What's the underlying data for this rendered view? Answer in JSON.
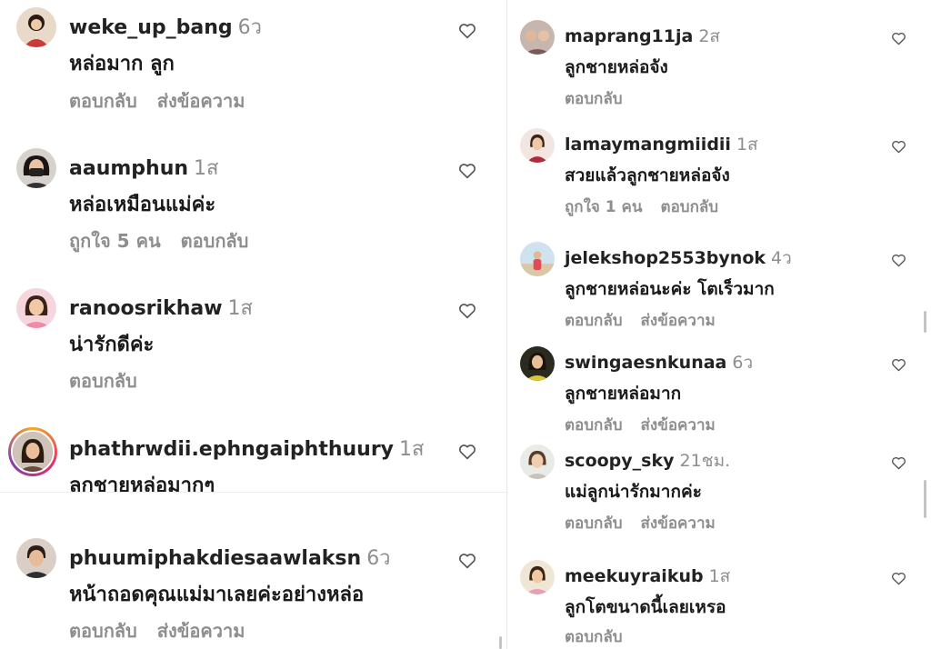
{
  "left_comments": [
    {
      "username": "weke_up_bang",
      "time": "6ว",
      "text": "หล่อมาก ลูก",
      "likes": "",
      "reply_label": "ตอบกลับ",
      "message_label": "ส่งข้อความ",
      "avatar_icon": "profile-photo"
    },
    {
      "username": "aaumphun",
      "time": "1ส",
      "text": "หล่อเหมือนแม่ค่ะ",
      "likes_prefix": "ถูกใจ",
      "likes": "5",
      "likes_suffix": "คน",
      "reply_label": "ตอบกลับ",
      "avatar_icon": "profile-photo"
    },
    {
      "username": "ranoosrikhaw",
      "time": "1ส",
      "text": "น่ารักดีค่ะ",
      "reply_label": "ตอบกลับ",
      "avatar_icon": "profile-photo"
    },
    {
      "username": "phathrwdii.ephngaiphthuury",
      "time": "1ส",
      "text": "ลูกชายหล่อมากๆ",
      "avatar_icon": "profile-photo-story-ring"
    },
    {
      "username": "phuumiphakdiesaawlaksn",
      "time": "6ว",
      "text": "หน้าถอดคุณแม่มาเลยค่ะอย่างหล่อ",
      "reply_label": "ตอบกลับ",
      "message_label": "ส่งข้อความ",
      "avatar_icon": "profile-photo"
    }
  ],
  "right_comments": [
    {
      "username": "maprang11ja",
      "time": "2ส",
      "text": "ลูกชายหล่อจัง",
      "reply_label": "ตอบกลับ",
      "avatar_icon": "profile-photo"
    },
    {
      "username": "lamaymangmiidii",
      "time": "1ส",
      "text": "สวยแล้วลูกชายหล่อจัง",
      "likes_prefix": "ถูกใจ",
      "likes": "1",
      "likes_suffix": "คน",
      "reply_label": "ตอบกลับ",
      "avatar_icon": "profile-photo"
    },
    {
      "username": "jelekshop2553bynok",
      "time": "4ว",
      "text": "ลูกชายหล่อนะค่ะ โตเร็วมาก",
      "reply_label": "ตอบกลับ",
      "message_label": "ส่งข้อความ",
      "avatar_icon": "profile-photo"
    },
    {
      "username": "swingaesnkunaa",
      "time": "6ว",
      "text": "ลูกชายหล่อมาก",
      "reply_label": "ตอบกลับ",
      "message_label": "ส่งข้อความ",
      "avatar_icon": "profile-photo"
    },
    {
      "username": "scoopy_sky",
      "time": "21ชม.",
      "text": "แม่ลูกน่ารักมากค่ะ",
      "reply_label": "ตอบกลับ",
      "message_label": "ส่งข้อความ",
      "avatar_icon": "profile-photo"
    },
    {
      "username": "meekuyraikub",
      "time": "1ส",
      "text": "ลูกโตขนาดนี้เลยเหรอ",
      "reply_label": "ตอบกลับ",
      "avatar_icon": "profile-photo"
    }
  ],
  "icons": {
    "like": "heart-outline-icon"
  },
  "colors": {
    "muted": "#8e8e8e",
    "text": "#1a1a1a",
    "heart": "#555555"
  }
}
